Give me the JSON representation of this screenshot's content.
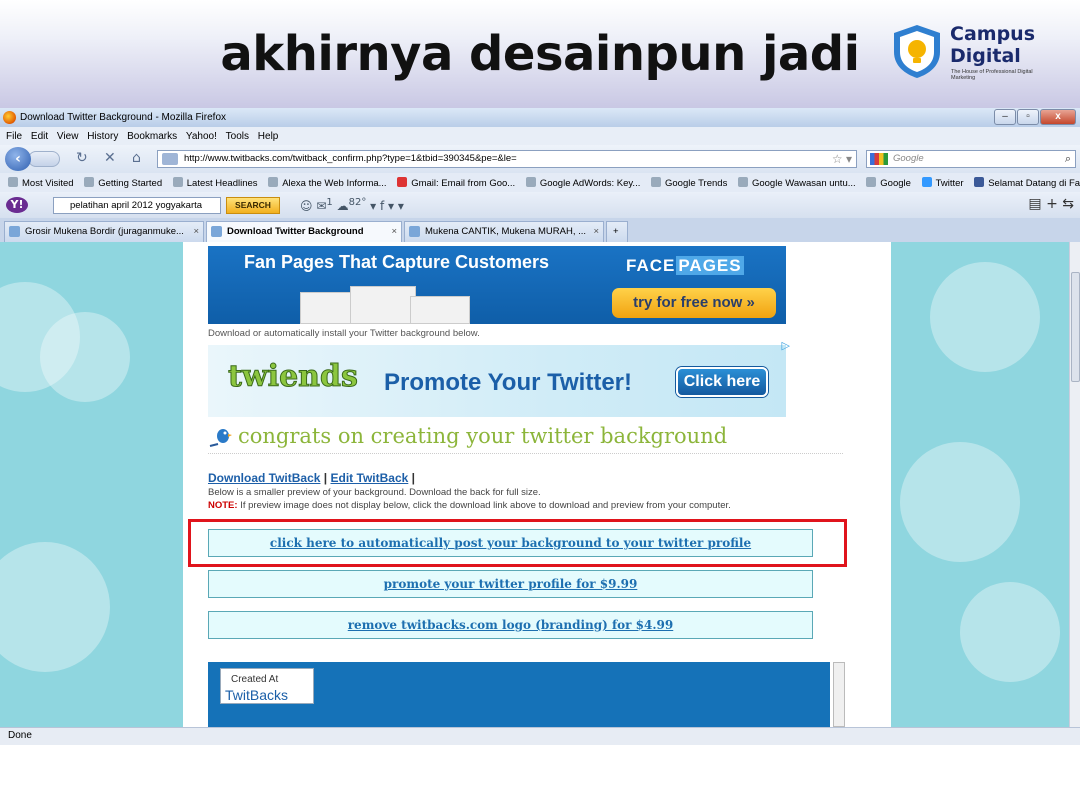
{
  "slide": {
    "title": "akhirnya desainpun jadi",
    "logo": {
      "line1": "Campus",
      "line2": "Digital",
      "tagline": "The House of Professional Digital Marketing"
    }
  },
  "browser": {
    "window_title": "Download Twitter Background - Mozilla Firefox",
    "menu": [
      "File",
      "Edit",
      "View",
      "History",
      "Bookmarks",
      "Yahoo!",
      "Tools",
      "Help"
    ],
    "url": "http://www.twitbacks.com/twitback_confirm.php?type=1&tbid=390345&pe=&le=",
    "search_placeholder": "Google",
    "bookmarks": [
      "Most Visited",
      "Getting Started",
      "Latest Headlines",
      "Alexa the Web Informa...",
      "Gmail: Email from Goo...",
      "Google AdWords: Key...",
      "Google Trends",
      "Google Wawasan untu...",
      "Google",
      "Twitter",
      "Selamat Datang di Fac..."
    ],
    "yahoo": {
      "search_value": "pelatihan april 2012 yogyakarta",
      "search_button": "SEARCH",
      "weather": "82°",
      "badge": "1"
    },
    "tabs": [
      {
        "label": "Grosir Mukena Bordir (juraganmuke...",
        "active": false
      },
      {
        "label": "Download Twitter Background",
        "active": true
      },
      {
        "label": "Mukena CANTIK, Mukena MURAH, ...",
        "active": false
      }
    ],
    "status": "Done"
  },
  "page": {
    "ad1": {
      "headline": "Fan Pages That Capture Customers",
      "brand_a": "FACE",
      "brand_b": "PAGES",
      "button": "try for free now »"
    },
    "note": "Download or automatically install your Twitter background below.",
    "ad2": {
      "logo": "twiends",
      "headline": "Promote Your Twitter!",
      "button": "Click here"
    },
    "congrats": "congrats on creating your twitter background",
    "download_link": "Download TwitBack",
    "edit_link": "Edit TwitBack",
    "separator": "|",
    "description": "Below is a smaller preview of your background. Download the back for full size.",
    "note_label": "NOTE:",
    "note_text": " If preview image does not display below, click the download link above to download and preview from your computer.",
    "links": [
      "click here to automatically post your background to your twitter profile",
      "promote your twitter profile for $9.99",
      "remove twitbacks.com logo (branding) for $4.99"
    ],
    "preview": {
      "created_at": "Created At",
      "brand": "TwitBacks"
    }
  },
  "colors": {
    "highlight": "#e0141c",
    "page_bg": "#8fd6df",
    "link": "#1d6fb0"
  }
}
